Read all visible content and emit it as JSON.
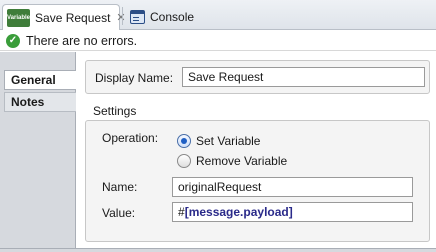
{
  "tabs": [
    {
      "icon": "variable-icon",
      "icon_text": "Variable",
      "label": "Save Request",
      "active": true
    },
    {
      "icon": "console-icon",
      "label": "Console",
      "active": false
    }
  ],
  "status": {
    "icon": "check-circle-icon",
    "text": "There are no errors."
  },
  "nav": [
    {
      "label": "General",
      "selected": true
    },
    {
      "label": "Notes",
      "selected": false
    }
  ],
  "display_name": {
    "label": "Display Name:",
    "value": "Save Request"
  },
  "settings": {
    "title": "Settings",
    "operation_label": "Operation:",
    "options": [
      {
        "label": "Set Variable",
        "checked": true
      },
      {
        "label": "Remove Variable",
        "checked": false
      }
    ],
    "name_label": "Name:",
    "name_value": "originalRequest",
    "value_label": "Value:",
    "value_prefix": "#",
    "value_open": "[",
    "value_expr": "message.payload",
    "value_close": "]"
  },
  "colors": {
    "accent": "#1f5fc4",
    "ok": "#3a9d3a",
    "variable_icon": "#3f7d3a",
    "expression": "#2a2a8a"
  }
}
